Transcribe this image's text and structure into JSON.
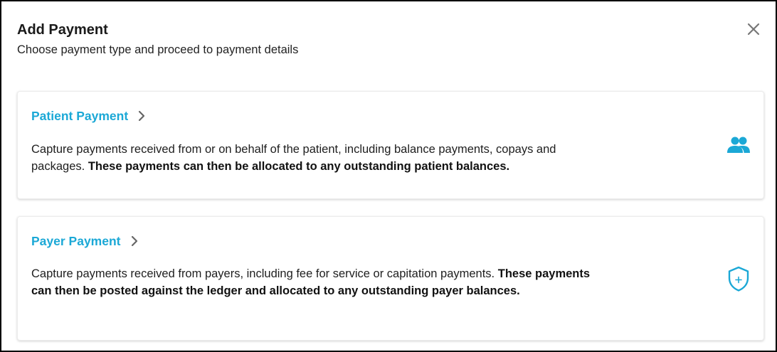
{
  "dialog": {
    "title": "Add Payment",
    "subtitle": "Choose payment type and proceed to payment details",
    "close_icon": "close-icon"
  },
  "cards": [
    {
      "title": "Patient Payment",
      "desc_plain": "Capture payments received from or on behalf of the patient, including balance payments, copays and packages. ",
      "desc_bold": "These payments can then be allocated to any outstanding patient balances.",
      "icon": "people-icon"
    },
    {
      "title": "Payer Payment",
      "desc_plain": "Capture payments received from payers, including fee for service or capitation payments. ",
      "desc_bold": "These payments can then be posted against the ledger and allocated to any outstanding payer balances.",
      "icon": "shield-plus-icon"
    }
  ],
  "colors": {
    "accent": "#1ba8d6",
    "text": "#1e1e1e",
    "close": "#777777",
    "chevron": "#666666"
  }
}
